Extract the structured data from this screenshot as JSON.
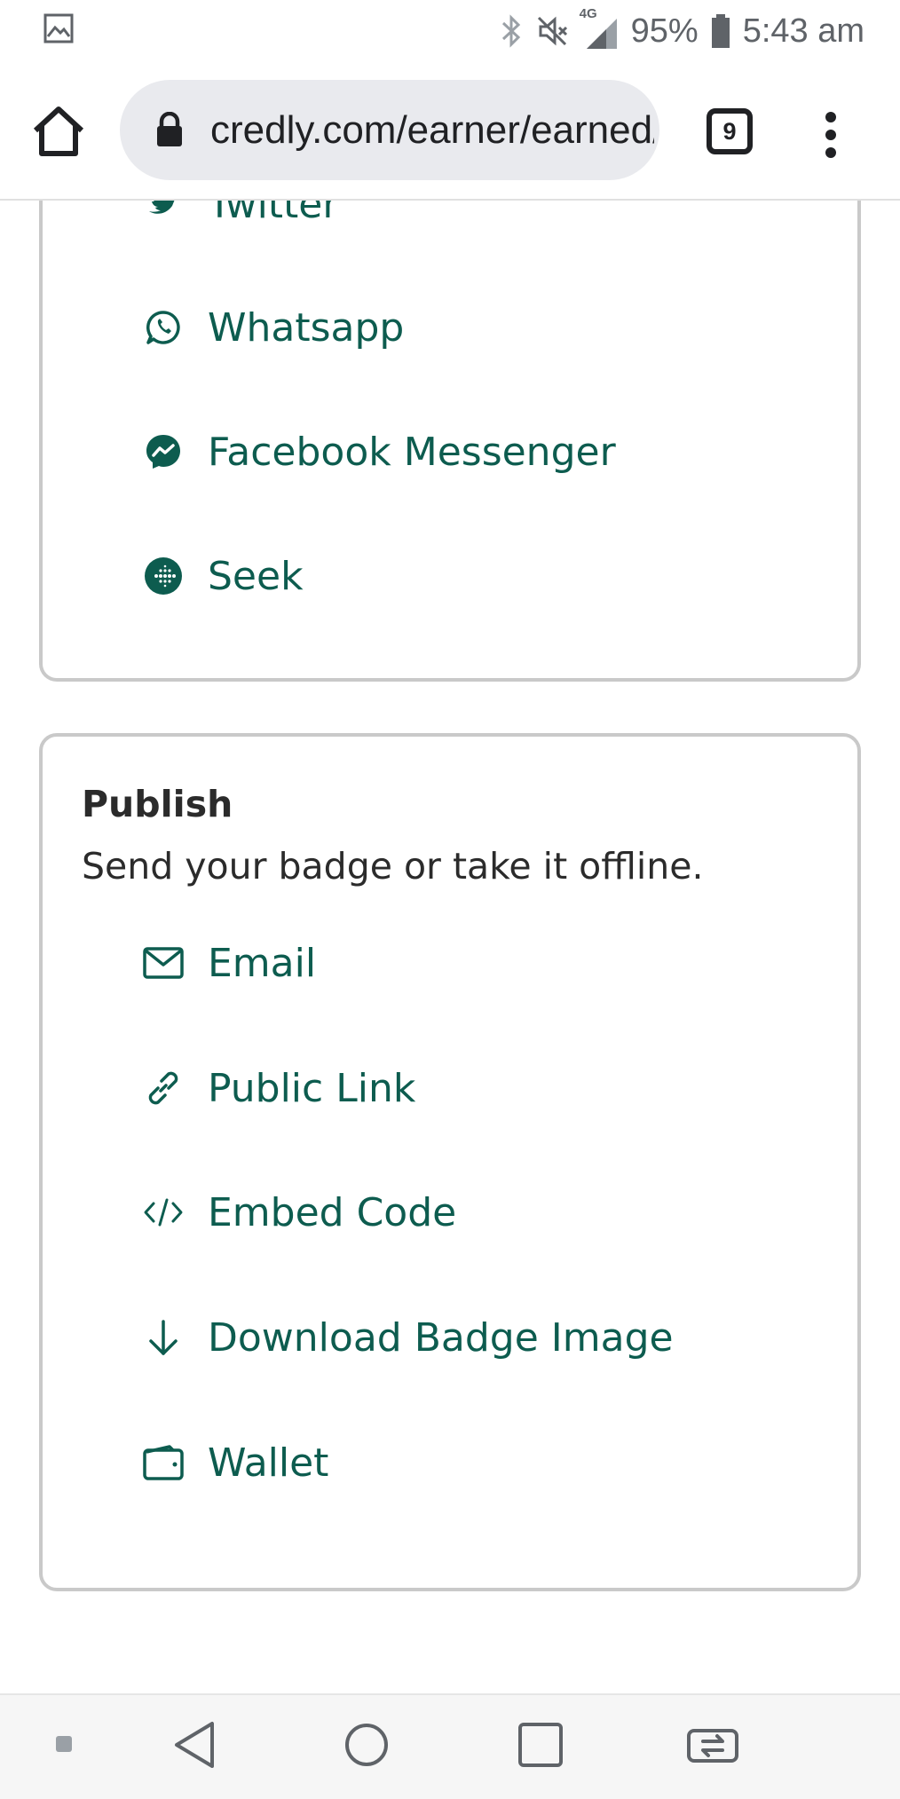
{
  "status_bar": {
    "network": "4G",
    "battery": "95%",
    "time": "5:43 am"
  },
  "browser": {
    "url": "credly.com/earner/earned/share",
    "tab_count": "9"
  },
  "share_card": {
    "items": [
      {
        "label": "Twitter",
        "icon": "twitter-icon"
      },
      {
        "label": "Whatsapp",
        "icon": "whatsapp-icon"
      },
      {
        "label": "Facebook Messenger",
        "icon": "messenger-icon"
      },
      {
        "label": "Seek",
        "icon": "seek-icon"
      }
    ]
  },
  "publish_card": {
    "title": "Publish",
    "subtitle": "Send your badge or take it offline.",
    "items": [
      {
        "label": "Email",
        "icon": "envelope-icon"
      },
      {
        "label": "Public Link",
        "icon": "link-icon"
      },
      {
        "label": "Embed Code",
        "icon": "code-icon"
      },
      {
        "label": "Download Badge Image",
        "icon": "download-icon"
      },
      {
        "label": "Wallet",
        "icon": "wallet-icon"
      }
    ]
  },
  "colors": {
    "link": "#0d5c4f",
    "text": "#2b2b2b",
    "card_border": "#c9c9c9"
  }
}
